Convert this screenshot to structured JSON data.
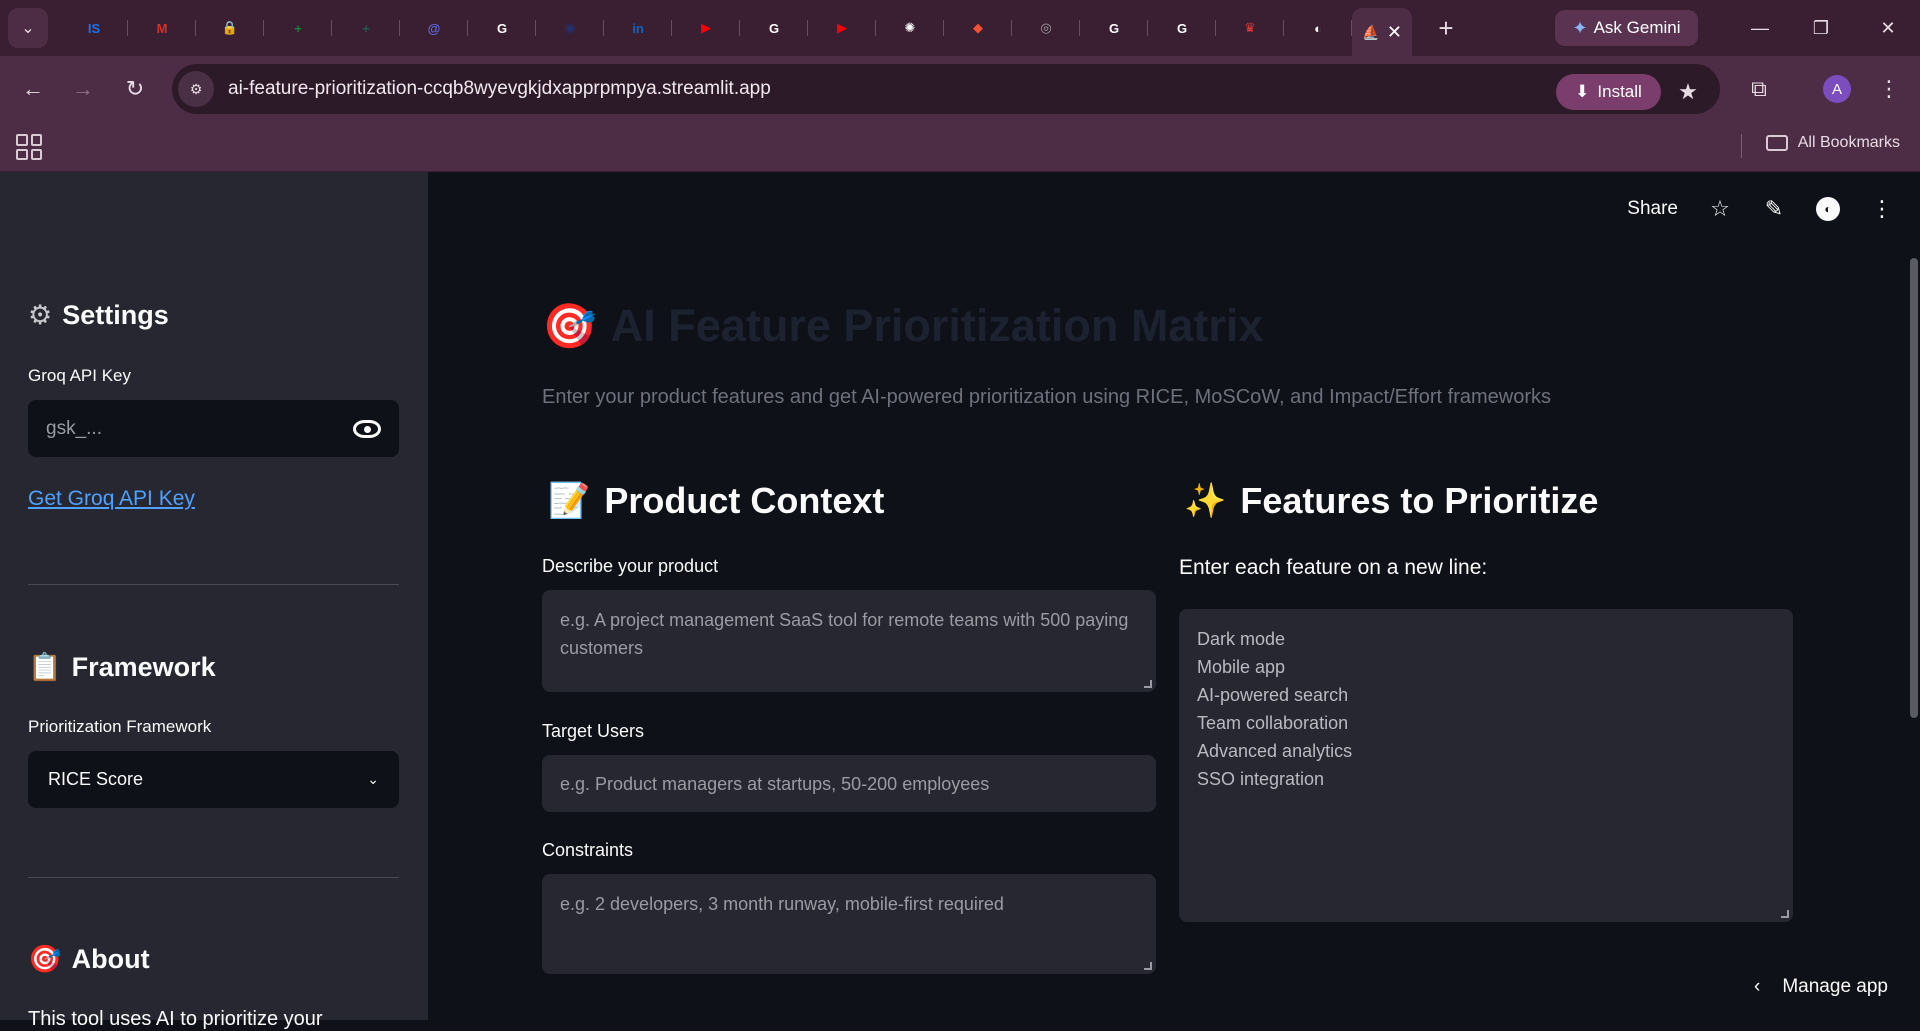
{
  "browser": {
    "tabs": [
      {
        "name": "ts",
        "label": "IS",
        "color": "#1a73e8"
      },
      {
        "name": "gmail",
        "label": "M",
        "color": "#d93025"
      },
      {
        "name": "lock",
        "label": "🔒",
        "color": "#2d7d46"
      },
      {
        "name": "sheets",
        "label": "+",
        "color": "#188038"
      },
      {
        "name": "add",
        "label": "+",
        "color": "#1e5c4a"
      },
      {
        "name": "app",
        "label": "@",
        "color": "#5b6be0"
      },
      {
        "name": "google1",
        "label": "G",
        "color": "#ffffff"
      },
      {
        "name": "circle",
        "label": "◉",
        "color": "#243069"
      },
      {
        "name": "linkedin",
        "label": "in",
        "color": "#0a66c2"
      },
      {
        "name": "youtube1",
        "label": "▶",
        "color": "#ff0000"
      },
      {
        "name": "google2",
        "label": "G",
        "color": "#ffffff"
      },
      {
        "name": "youtube2",
        "label": "▶",
        "color": "#ff0000"
      },
      {
        "name": "chatgpt",
        "label": "✺",
        "color": "#ffffff"
      },
      {
        "name": "git",
        "label": "◆",
        "color": "#f05133"
      },
      {
        "name": "chrome",
        "label": "◎",
        "color": "#9e9e9e"
      },
      {
        "name": "google3",
        "label": "G",
        "color": "#ffffff"
      },
      {
        "name": "google4",
        "label": "G",
        "color": "#ffffff"
      },
      {
        "name": "crown",
        "label": "♛",
        "color": "#e53935"
      },
      {
        "name": "github",
        "label": "◐",
        "color": "#ffffff"
      }
    ],
    "ask_gemini": "Ask Gemini",
    "url": "ai-feature-prioritization-ccqb8wyevgkjdxapprpmpya.streamlit.app",
    "install": "Install",
    "all_bookmarks": "All Bookmarks",
    "avatar_letter": "A"
  },
  "sidebar": {
    "settings_title": "Settings",
    "api_key_label": "Groq API Key",
    "api_key_placeholder": "gsk_...",
    "api_key_link": "Get Groq API Key",
    "framework_title": "Framework",
    "framework_label": "Prioritization Framework",
    "framework_value": "RICE Score",
    "about_title": "About",
    "about_text": "This tool uses AI to prioritize your"
  },
  "main": {
    "share": "Share",
    "title": "AI Feature Prioritization Matrix",
    "subtitle": "Enter your product features and get AI-powered prioritization using RICE, MoSCoW, and Impact/Effort frameworks",
    "product_context": {
      "heading": "Product Context",
      "describe_label": "Describe your product",
      "describe_placeholder": "e.g. A project management SaaS tool for remote teams with 500 paying customers",
      "target_label": "Target Users",
      "target_placeholder": "e.g. Product managers at startups, 50-200 employees",
      "constraints_label": "Constraints",
      "constraints_placeholder": "e.g. 2 developers, 3 month runway, mobile-first required"
    },
    "features": {
      "heading": "Features to Prioritize",
      "label": "Enter each feature on a new line:",
      "items": [
        "Dark mode",
        "Mobile app",
        "AI-powered search",
        "Team collaboration",
        "Advanced analytics",
        "SSO integration"
      ]
    },
    "manage_app": "Manage app"
  }
}
